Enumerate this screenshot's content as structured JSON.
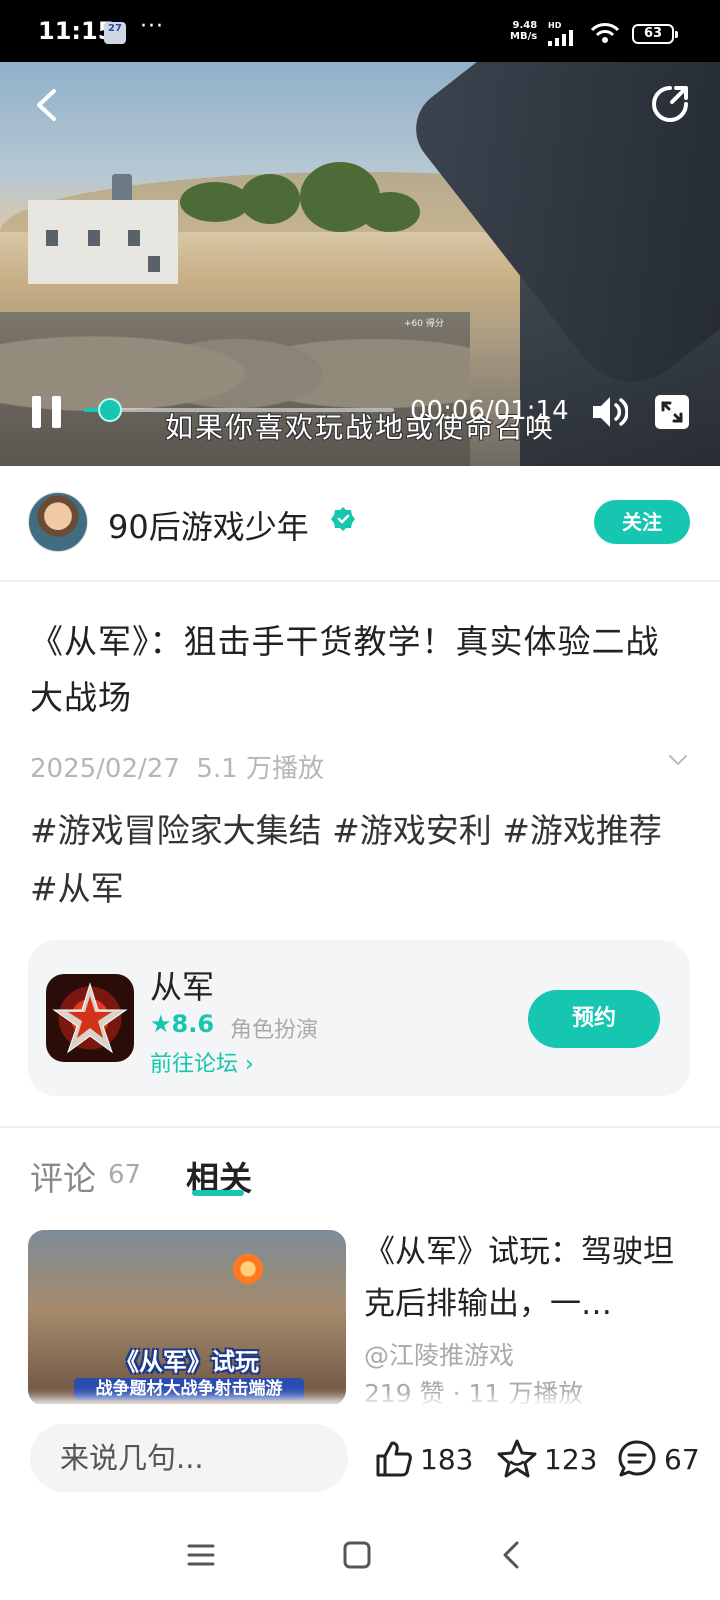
{
  "status_bar": {
    "time": "11:15",
    "calendar_badge": "27",
    "more": "···",
    "net_speed_value": "9.48",
    "net_speed_unit": "MB/s",
    "hd": "HD",
    "battery": "63"
  },
  "video": {
    "subtitle": "如果你喜欢玩战地或使命召唤",
    "current_time": "00:06",
    "duration": "01:14",
    "time_display": "00:06/01:14",
    "progress": 0.085,
    "hud_score": "+60 得分"
  },
  "author": {
    "name": "90后游戏少年",
    "follow_label": "关注"
  },
  "post": {
    "title": "《从军》：狙击手干货教学！真实体验二战大战场",
    "date": "2025/02/27",
    "plays": "5.1 万播放",
    "tags": "#游戏冒险家大集结 #游戏安利 #游戏推荐 #从军"
  },
  "game_card": {
    "name": "从军",
    "rating": "8.6",
    "genre": "角色扮演",
    "forum_link": "前往论坛",
    "reserve_label": "预约"
  },
  "tabs": {
    "comments_label": "评论",
    "comments_count": "67",
    "related_label": "相关"
  },
  "related": [
    {
      "thumb_title": "《从军》试玩",
      "thumb_subtitle": "战争题材大战争射击端游",
      "title": "《从军》试玩：驾驶坦克后排输出，一…",
      "author": "@江陵推游戏",
      "stats": "219 赞 · 11 万播放"
    }
  ],
  "bottom_bar": {
    "comment_placeholder": "来说几句...",
    "likes": "183",
    "favorites": "123",
    "comments": "67"
  },
  "colors": {
    "accent": "#17c6b0"
  }
}
